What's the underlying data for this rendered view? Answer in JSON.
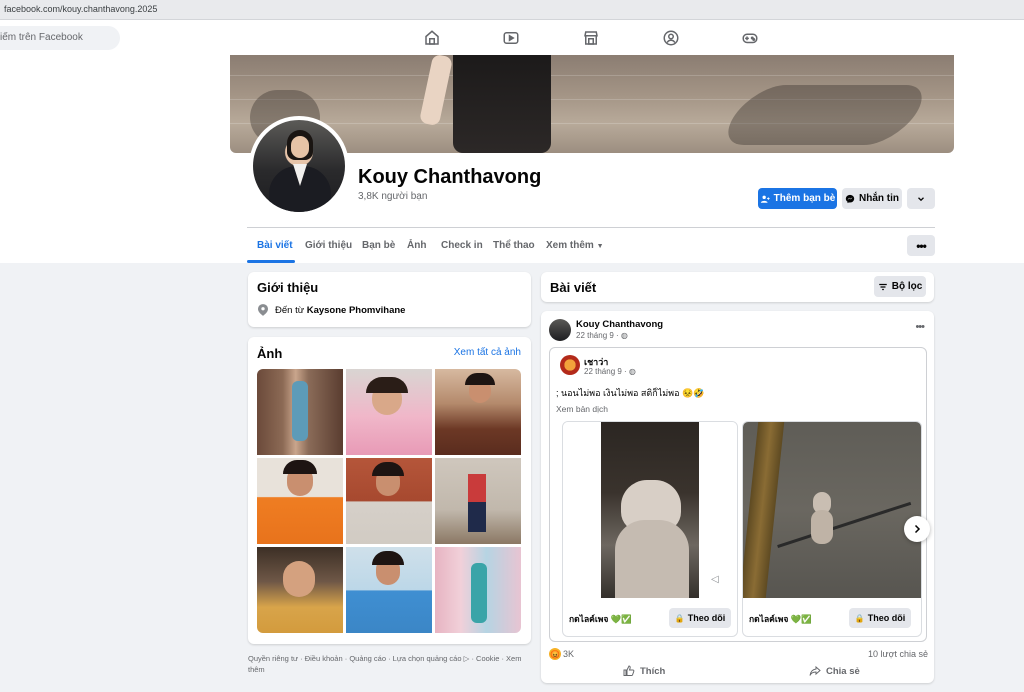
{
  "browser": {
    "url": "facebook.com/kouy.chanthavong.2025"
  },
  "topnav": {
    "search_placeholder": "iếm trên Facebook",
    "icons": [
      "home-icon",
      "video-icon",
      "marketplace-icon",
      "groups-icon",
      "gaming-icon"
    ]
  },
  "profile": {
    "name": "Kouy Chanthavong",
    "friends_count": "3,8K người bạn",
    "add_friend_label": "Thêm bạn bè",
    "message_label": "Nhắn tin"
  },
  "tabs": [
    {
      "label": "Bài viết",
      "active": true
    },
    {
      "label": "Giới thiệu"
    },
    {
      "label": "Bạn bè"
    },
    {
      "label": "Ảnh"
    },
    {
      "label": "Check in"
    },
    {
      "label": "Thể thao"
    },
    {
      "label": "Xem thêm"
    }
  ],
  "intro": {
    "title": "Giới thiệu",
    "from_prefix": "Đến từ ",
    "from_place": "Kaysone Phomvihane"
  },
  "photos": {
    "title": "Ảnh",
    "see_all": "Xem tất cả ảnh"
  },
  "footer": {
    "text": "Quyền riêng tư · Điều khoản · Quảng cáo · Lựa chọn quảng cáo ▷ · Cookie · Xem thêm"
  },
  "posts_header": {
    "title": "Bài viết",
    "filter_label": "Bộ lọc"
  },
  "post": {
    "author": "Kouy Chanthavong",
    "date": "22 tháng 9 · ",
    "shared": {
      "author": "เชาว่า",
      "date": "22 tháng 9 · ",
      "text": "; นอนไม่พอ เงินไม่พอ สติก็ไม่พอ 😣🤣",
      "translate": "Xem bản dịch"
    },
    "tiles": [
      {
        "page": "กดไลค์เพจ 💚✅",
        "follow": "Theo dõi"
      },
      {
        "page": "กดไลค์เพจ 💚✅",
        "follow": "Theo dõi"
      }
    ],
    "reactions_count": "3K",
    "shares_count": "10 lượt chia sẻ",
    "like_label": "Thích",
    "share_label": "Chia sẻ"
  },
  "colors": {
    "accent": "#1b74e4",
    "background": "#f0f2f5"
  }
}
